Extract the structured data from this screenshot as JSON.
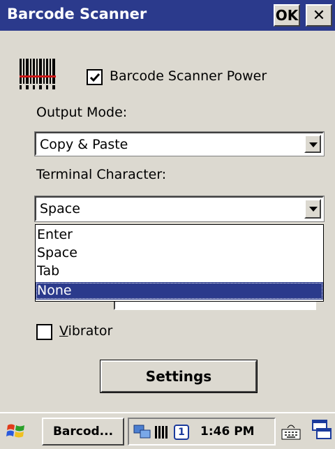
{
  "window": {
    "title": "Barcode Scanner",
    "ok_label": "OK",
    "close_label": "✕"
  },
  "power": {
    "label": "Barcode Scanner Power",
    "checked": true
  },
  "output_mode": {
    "label": "Output Mode:",
    "value": "Copy & Paste"
  },
  "terminal_char": {
    "label": "Terminal Character:",
    "value": "Space",
    "options": [
      "Enter",
      "Space",
      "Tab",
      "None"
    ],
    "highlighted": "None"
  },
  "vibrator": {
    "label_prefix": "V",
    "label_rest": "ibrator",
    "checked": false
  },
  "settings_button": "Settings",
  "taskbar": {
    "task_label": "Barcod...",
    "time": "1:46 PM",
    "badge": "1"
  },
  "colors": {
    "titlebar": "#2b3a8c",
    "face": "#dcd9d0",
    "selection": "#2b3a8c"
  }
}
